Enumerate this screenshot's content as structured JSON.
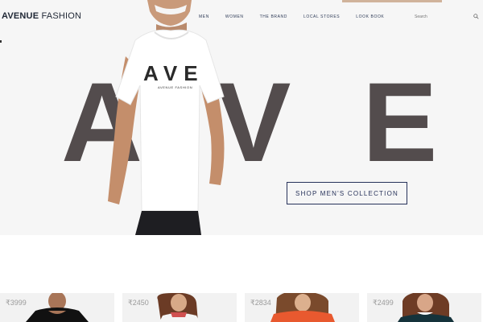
{
  "brand": {
    "strong": "AVENUE",
    "light": " FASHION"
  },
  "nav": [
    "MEN",
    "WOMEN",
    "THE BRAND",
    "LOCAL STORES",
    "LOOK BOOK"
  ],
  "search": {
    "placeholder": "Search"
  },
  "hero": {
    "big_letters": [
      "A",
      "V",
      "E"
    ],
    "tshirt_text": "AVE",
    "tshirt_subtext": "AVENUE FASHION",
    "cta_label": "SHOP MEN'S COLLECTION"
  },
  "products": [
    {
      "price": "₹3999"
    },
    {
      "price": "₹2450"
    },
    {
      "price": "₹2834"
    },
    {
      "price": "₹2499"
    }
  ],
  "colors": {
    "accent": "#27325a",
    "big_letter": "#534c4d",
    "hero_bg": "#f6f6f6"
  }
}
